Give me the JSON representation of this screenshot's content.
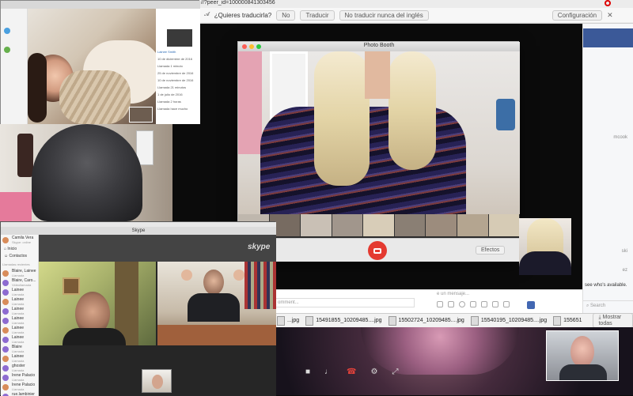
{
  "browser": {
    "url": "//?peer_id=100000841303456",
    "translate_prompt": "¿Quieres traducirla?",
    "no_label": "No",
    "translate_label": "Traducir",
    "never_label": "No traducir nunca del inglés",
    "settings_label": "Configuración"
  },
  "photo_booth": {
    "title": "Photo Booth",
    "effects_label": "Efectos"
  },
  "skype": {
    "title": "Skype",
    "logo": "skype",
    "user_name": "Camila Vera",
    "user_status": "Skype: online",
    "nav": [
      "Inicio",
      "Contactos"
    ],
    "recents_header": "Llamadas recientes",
    "contacts": [
      {
        "name": "Blaire, Lainee",
        "sub": "Llamada"
      },
      {
        "name": "Blaire, Caro...",
        "sub": "Videollamada"
      },
      {
        "name": "Lainee",
        "sub": "Llamada"
      },
      {
        "name": "Lainee",
        "sub": "Llamada"
      },
      {
        "name": "Lainee",
        "sub": "Llamada"
      },
      {
        "name": "Lainee",
        "sub": "Llamada"
      },
      {
        "name": "Lainee",
        "sub": "Llamada"
      },
      {
        "name": "Lainee",
        "sub": "Llamada"
      },
      {
        "name": "Blaire",
        "sub": "Llamada"
      },
      {
        "name": "Lainee",
        "sub": "Llamada"
      },
      {
        "name": "ghoster",
        "sub": "Llamada"
      },
      {
        "name": "Irene Palacio",
        "sub": "Llamada"
      },
      {
        "name": "Irene Palacio",
        "sub": "Llamada"
      },
      {
        "name": "rue.lambinier",
        "sub": "Llamada"
      }
    ]
  },
  "facebook_chat": {
    "placeholder_comment": "omment...",
    "placeholder_message": "e un mensaje...",
    "notice": "see who's available.",
    "search_placeholder": "Search",
    "names": [
      "",
      "",
      "",
      "",
      "mcook",
      "",
      "",
      "",
      "",
      "",
      "ski",
      "ez",
      "",
      "Jerrido",
      "hikova",
      ""
    ]
  },
  "downloads": {
    "items": [
      "...jpg",
      "15491855_10209485....jpg",
      "15502724_10209485....jpg",
      "15540195_10209485....jpg",
      "155651"
    ],
    "show_all_label": "Mostrar todas"
  },
  "skype_left_panel": {
    "rows": [
      "Lainee Smith",
      "10 de diciembre de 2016",
      "Llamada 1 minuto",
      "25 de noviembre de 2016",
      "10 de noviembre de 2016",
      "Llamada 21 minutos",
      "1 de julio de 2016",
      "Llamada 2 horas",
      "Llamada hace mucho",
      "Llamada",
      "Hola"
    ]
  }
}
